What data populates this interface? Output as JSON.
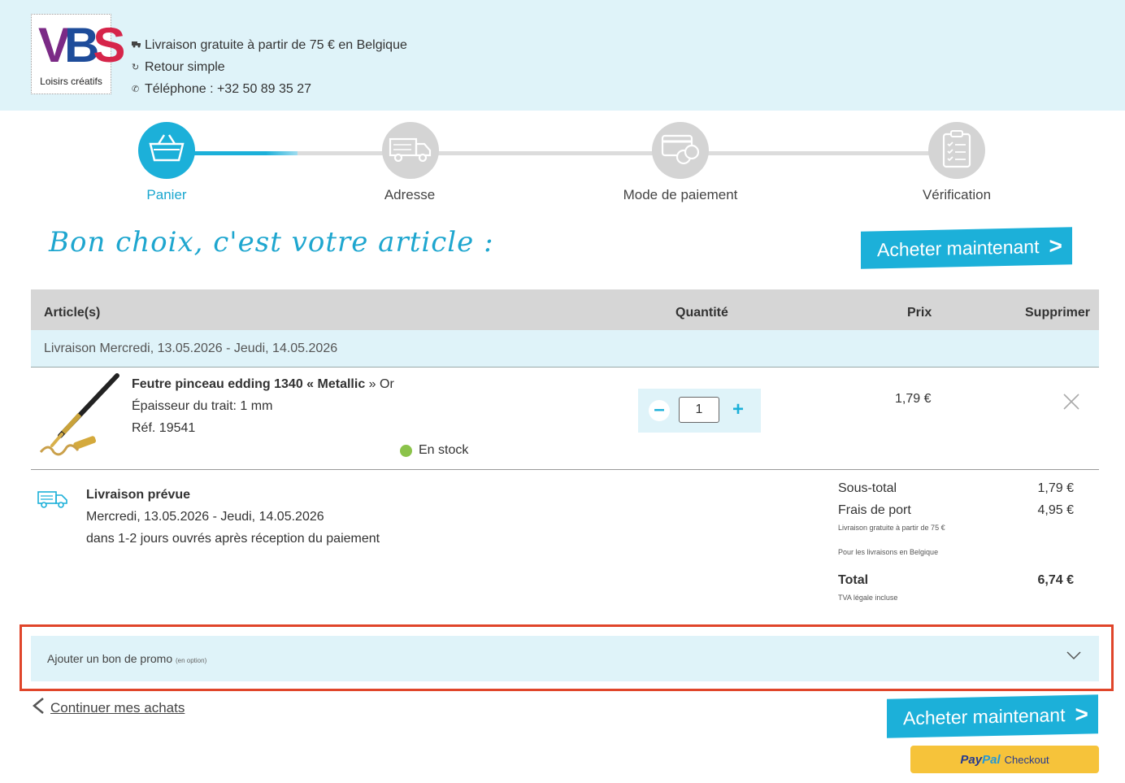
{
  "header": {
    "logo_text": "VBS",
    "logo_sub": "Loisirs créatifs",
    "infos": [
      {
        "icon": "truck-icon",
        "text": "Livraison gratuite à partir de 75 € en Belgique"
      },
      {
        "icon": "return-icon",
        "text": "Retour simple"
      },
      {
        "icon": "phone-icon",
        "text": "Téléphone : +32 50 89 35 27"
      }
    ]
  },
  "steps": [
    {
      "label": "Panier",
      "icon": "basket-icon",
      "active": true
    },
    {
      "label": "Adresse",
      "icon": "truck-icon",
      "active": false
    },
    {
      "label": "Mode de paiement",
      "icon": "payment-card-icon",
      "active": false
    },
    {
      "label": "Vérification",
      "icon": "checklist-icon",
      "active": false
    }
  ],
  "headline": "Bon choix, c'est votre article :",
  "buy_label": "Acheter maintenant",
  "table": {
    "headers": {
      "article": "Article(s)",
      "quantity": "Quantité",
      "price": "Prix",
      "remove": "Supprimer"
    },
    "delivery_band": "Livraison Mercredi, 13.05.2026 - Jeudi, 14.05.2026"
  },
  "item": {
    "title": "Feutre pinceau edding 1340 « Metallic » Or",
    "title_parts": [
      "Feutre pinceau edding 1340 «",
      " Metallic ",
      "» Or"
    ],
    "thickness": "Épaisseur du trait: 1 mm",
    "ref": "Réf. 19541",
    "stock": "En stock",
    "quantity": "1",
    "price": "1,79 €"
  },
  "planned": {
    "title": "Livraison prévue",
    "dates": "Mercredi, 13.05.2026 - Jeudi, 14.05.2026",
    "note": "dans 1-2 jours ouvrés après réception du paiement"
  },
  "totals": {
    "subtotal_label": "Sous-total",
    "subtotal_value": "1,79 €",
    "shipping_label": "Frais de port",
    "shipping_value": "4,95 €",
    "shipping_note_1": "Livraison gratuite à partir de 75 €",
    "shipping_note_2": "Pour les livraisons en Belgique",
    "total_label": "Total",
    "total_value": "6,74 €",
    "vat_note": "TVA légale incluse"
  },
  "promo": {
    "label": "Ajouter un bon de promo",
    "optional": "(en option)"
  },
  "continue_label": "Continuer mes achats",
  "paypal": {
    "brand_1": "Pay",
    "brand_2": "Pal",
    "label": "Checkout"
  },
  "colors": {
    "accent": "#1cb0d9",
    "band": "#dff3f9",
    "highlight_border": "#e0452a",
    "paypal": "#f6c33a"
  }
}
